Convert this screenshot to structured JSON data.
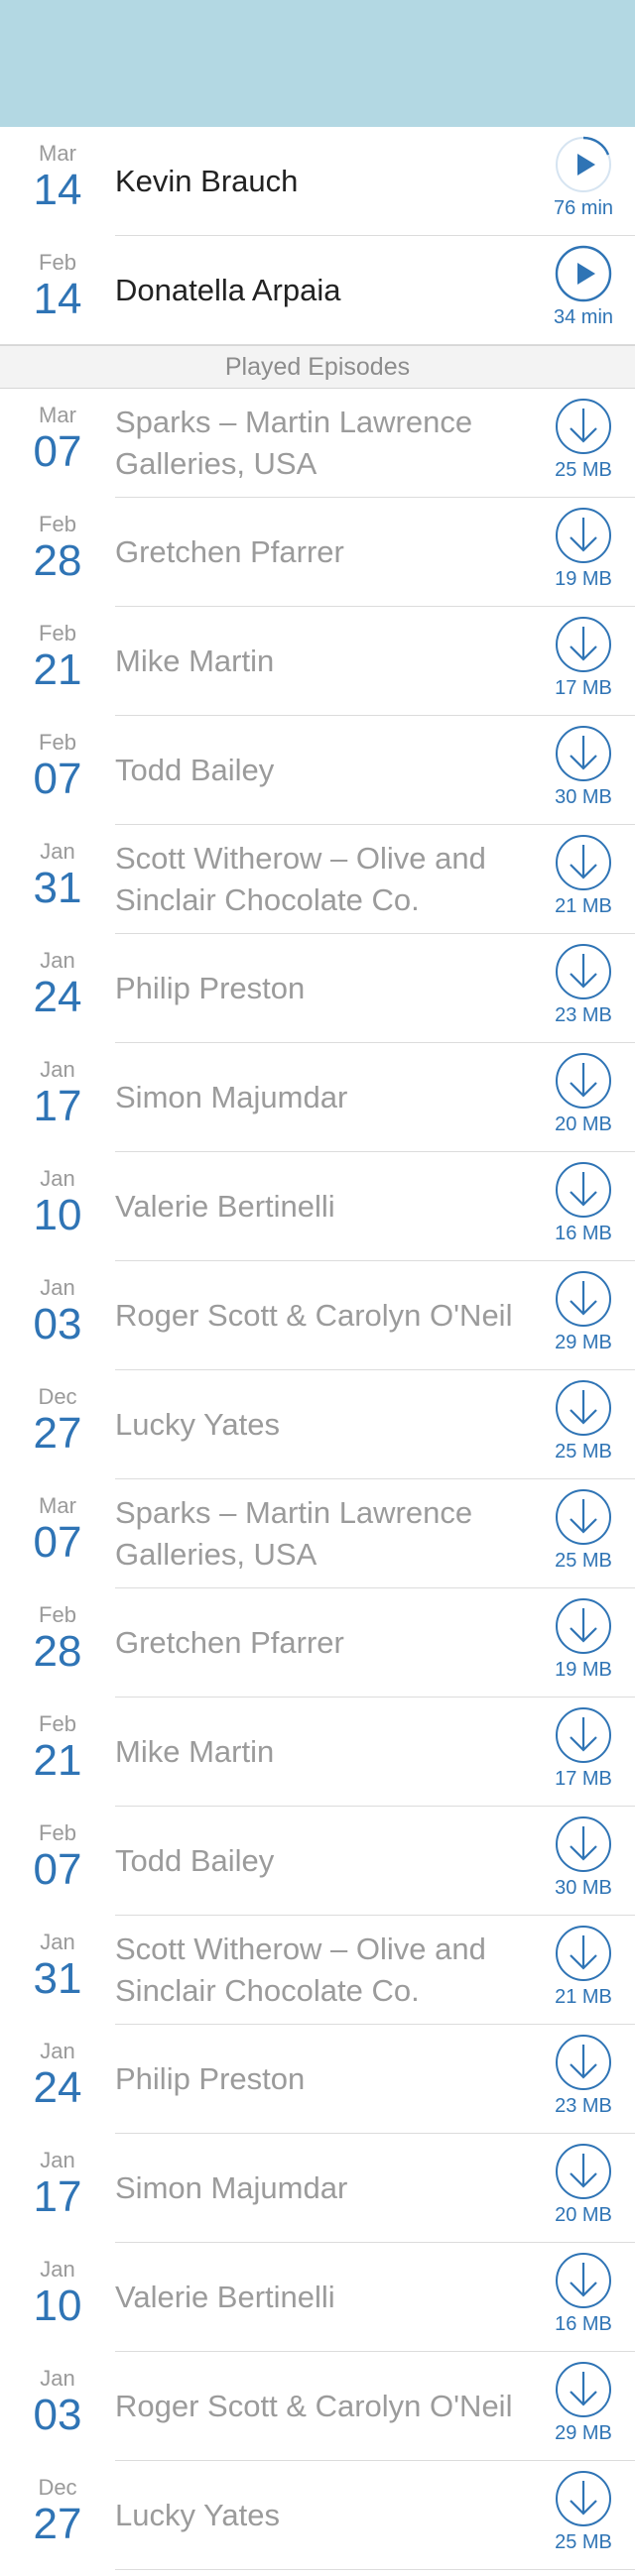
{
  "theme": {
    "accent": "#2f74b5",
    "header_color": "#b3d8e3",
    "played_text": "#9b9b9b",
    "unplayed_text": "#222222"
  },
  "unplayed": [
    {
      "month": "Mar",
      "day": "14",
      "title": "Kevin Brauch",
      "meta": "76 min",
      "icon": "play-progress-icon"
    },
    {
      "month": "Feb",
      "day": "14",
      "title": "Donatella Arpaia",
      "meta": "34 min",
      "icon": "play-icon"
    }
  ],
  "played_header": "Played Episodes",
  "played": [
    {
      "month": "Mar",
      "day": "07",
      "title": "Sparks – Martin Lawrence Galleries, USA",
      "meta": "25 MB",
      "icon": "download-icon"
    },
    {
      "month": "Feb",
      "day": "28",
      "title": "Gretchen Pfarrer",
      "meta": "19 MB",
      "icon": "download-icon"
    },
    {
      "month": "Feb",
      "day": "21",
      "title": "Mike Martin",
      "meta": "17 MB",
      "icon": "download-icon"
    },
    {
      "month": "Feb",
      "day": "07",
      "title": "Todd Bailey",
      "meta": "30 MB",
      "icon": "download-icon"
    },
    {
      "month": "Jan",
      "day": "31",
      "title": "Scott Witherow – Olive and Sinclair Chocolate Co.",
      "meta": "21 MB",
      "icon": "download-icon"
    },
    {
      "month": "Jan",
      "day": "24",
      "title": "Philip Preston",
      "meta": "23 MB",
      "icon": "download-icon"
    },
    {
      "month": "Jan",
      "day": "17",
      "title": "Simon Majumdar",
      "meta": "20 MB",
      "icon": "download-icon"
    },
    {
      "month": "Jan",
      "day": "10",
      "title": "Valerie Bertinelli",
      "meta": "16 MB",
      "icon": "download-icon"
    },
    {
      "month": "Jan",
      "day": "03",
      "title": "Roger Scott & Carolyn O'Neil",
      "meta": "29 MB",
      "icon": "download-icon"
    },
    {
      "month": "Dec",
      "day": "27",
      "title": "Lucky Yates",
      "meta": "25 MB",
      "icon": "download-icon"
    },
    {
      "month": "Mar",
      "day": "07",
      "title": "Sparks – Martin Lawrence Galleries, USA",
      "meta": "25 MB",
      "icon": "download-icon"
    },
    {
      "month": "Feb",
      "day": "28",
      "title": "Gretchen Pfarrer",
      "meta": "19 MB",
      "icon": "download-icon"
    },
    {
      "month": "Feb",
      "day": "21",
      "title": "Mike Martin",
      "meta": "17 MB",
      "icon": "download-icon"
    },
    {
      "month": "Feb",
      "day": "07",
      "title": "Todd Bailey",
      "meta": "30 MB",
      "icon": "download-icon"
    },
    {
      "month": "Jan",
      "day": "31",
      "title": "Scott Witherow – Olive and Sinclair Chocolate Co.",
      "meta": "21 MB",
      "icon": "download-icon"
    },
    {
      "month": "Jan",
      "day": "24",
      "title": "Philip Preston",
      "meta": "23 MB",
      "icon": "download-icon"
    },
    {
      "month": "Jan",
      "day": "17",
      "title": "Simon Majumdar",
      "meta": "20 MB",
      "icon": "download-icon"
    },
    {
      "month": "Jan",
      "day": "10",
      "title": "Valerie Bertinelli",
      "meta": "16 MB",
      "icon": "download-icon"
    },
    {
      "month": "Jan",
      "day": "03",
      "title": "Roger Scott & Carolyn O'Neil",
      "meta": "29 MB",
      "icon": "download-icon"
    },
    {
      "month": "Dec",
      "day": "27",
      "title": "Lucky Yates",
      "meta": "25 MB",
      "icon": "download-icon"
    }
  ]
}
